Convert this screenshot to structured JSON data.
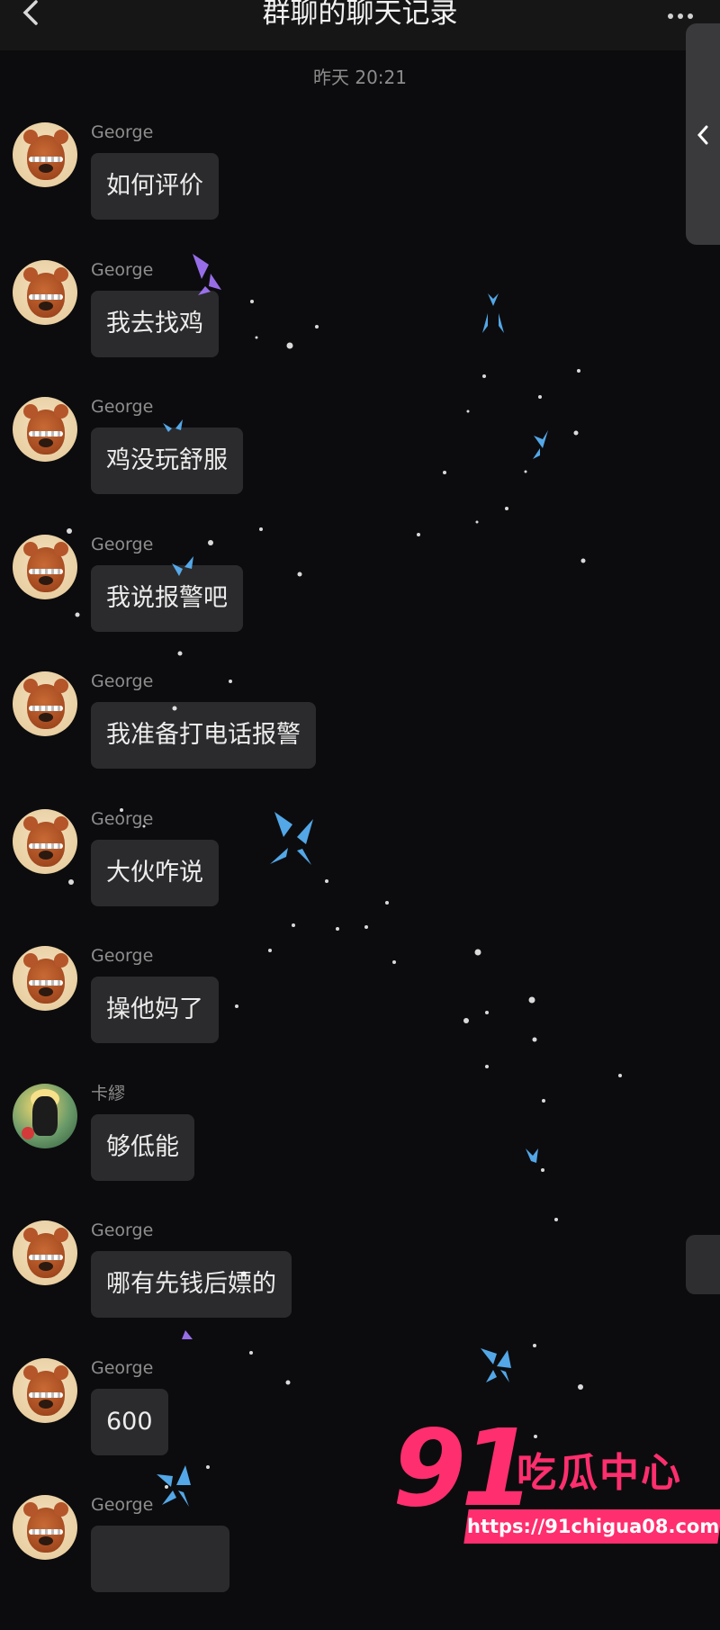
{
  "header": {
    "title": "群聊的聊天记录"
  },
  "timestamp": "昨天 20:21",
  "messages": [
    {
      "name": "George",
      "text": "如何评价",
      "avatar": "bear-avatar"
    },
    {
      "name": "George",
      "text": "我去找鸡",
      "avatar": "bear-avatar"
    },
    {
      "name": "George",
      "text": "鸡没玩舒服",
      "avatar": "bear-avatar"
    },
    {
      "name": "George",
      "text": "我说报警吧",
      "avatar": "bear-avatar"
    },
    {
      "name": "George",
      "text": "我准备打电话报警",
      "avatar": "bear-avatar"
    },
    {
      "name": "George",
      "text": "大伙咋说",
      "avatar": "bear-avatar"
    },
    {
      "name": "George",
      "text": "操他妈了",
      "avatar": "bear-avatar"
    },
    {
      "name": "卡繆",
      "text": "够低能",
      "avatar": "character-avatar"
    },
    {
      "name": "George",
      "text": "哪有先钱后嫖的",
      "avatar": "bear-avatar"
    },
    {
      "name": "George",
      "text": "600",
      "avatar": "bear-avatar"
    },
    {
      "name": "George",
      "text": "",
      "avatar": "bear-avatar"
    }
  ],
  "watermark": {
    "number": "91",
    "text": "吃瓜中心",
    "url": "https://91chigua08.com"
  },
  "colors": {
    "background": "#0c0c0e",
    "bubble": "#2b2b2d",
    "watermark": "#ff2e6e",
    "butterfly": "#5bb8ff"
  }
}
